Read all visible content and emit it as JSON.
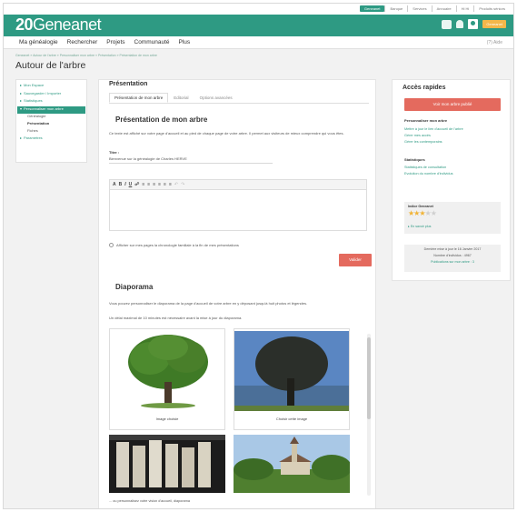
{
  "top_links": [
    "Geneanet",
    "Banque",
    "Services",
    "Annuaire",
    "Hi Hi",
    "Produits séniors"
  ],
  "header": {
    "logo_pre": "2",
    "logo_mid": "0",
    "logo_post": "Geneanet",
    "badge": "Geneanet"
  },
  "nav": {
    "items": [
      "Ma généalogie",
      "Rechercher",
      "Projets",
      "Communauté",
      "Plus"
    ],
    "aide": "(?) Aide"
  },
  "breadcrumb": "Geneanet » Autour de l'arbre » Personnaliser mon arbre » Présentation » Présentation de mon arbre",
  "page_title": "Autour de l'arbre",
  "sidebar": {
    "items": [
      "Mon Espace",
      "Sauvegarder / Importer",
      "Statistiques",
      "Personnaliser mon arbre",
      "Paramètres"
    ],
    "subitems": [
      "Généalogie",
      "Présentation",
      "Fiches"
    ]
  },
  "main": {
    "heading": "Présentation",
    "tabs": [
      "Présentation de mon arbre",
      "Editorial",
      "Options avancées"
    ],
    "section1_title": "Présentation de mon arbre",
    "description": "Ce texte est affiché sur votre page d'accueil et au pied de chaque page de votre arbre. Il permet aux visiteurs de mieux comprendre qui vous êtes.",
    "title_label": "Titre :",
    "title_value": "Bienvenue sur la généalogie de Charles HERVE",
    "toolbar": [
      "A",
      "B",
      "I",
      "U"
    ],
    "checkbox_label": "Afficher sur mes pages la chronologie familiale à la fin de mes présentations",
    "save_label": "Valider",
    "section2_title": "Diaporama",
    "diaporama_desc": "Vous pouvez personnaliser le diaporama de la page d'accueil de votre arbre en y déposant jusqu'à huit photos et légendes.",
    "diaporama_note": "Un délai maximal de 10 minutes est nécessaire avant la mise à jour du diaporama.",
    "gallery": [
      {
        "caption": "Image choisie"
      },
      {
        "caption": "Choisir cette image"
      },
      {
        "caption": ""
      },
      {
        "caption": ""
      }
    ],
    "gallery_footer": "... ou personnalisez votre vision d'accueil, diaporama"
  },
  "right": {
    "title": "Accès rapides",
    "button": "Voir mon arbre publié",
    "h1": "Personnaliser mon arbre",
    "links": [
      "Mettre à jour le lien d'accueil de l'arbre",
      "Gérer mes accès",
      "Gérer les contemporains"
    ],
    "h2": "Statistiques",
    "links2": [
      "Statistiques de consultation",
      "Evolution du nombre d'individus"
    ],
    "rating_label": "Indice Geneanet",
    "rating": 3,
    "rating_max": 5,
    "rating_link": "En savoir plus",
    "update_line1": "Dernière mise à jour le 16 Janvier 2017",
    "update_line2": "Nombre d'individus : 4967",
    "update_line3": "Publications sur mon arbre : 3"
  },
  "colors": {
    "brand": "#2e9a83",
    "accent": "#e46a5e",
    "star": "#f1b335"
  }
}
